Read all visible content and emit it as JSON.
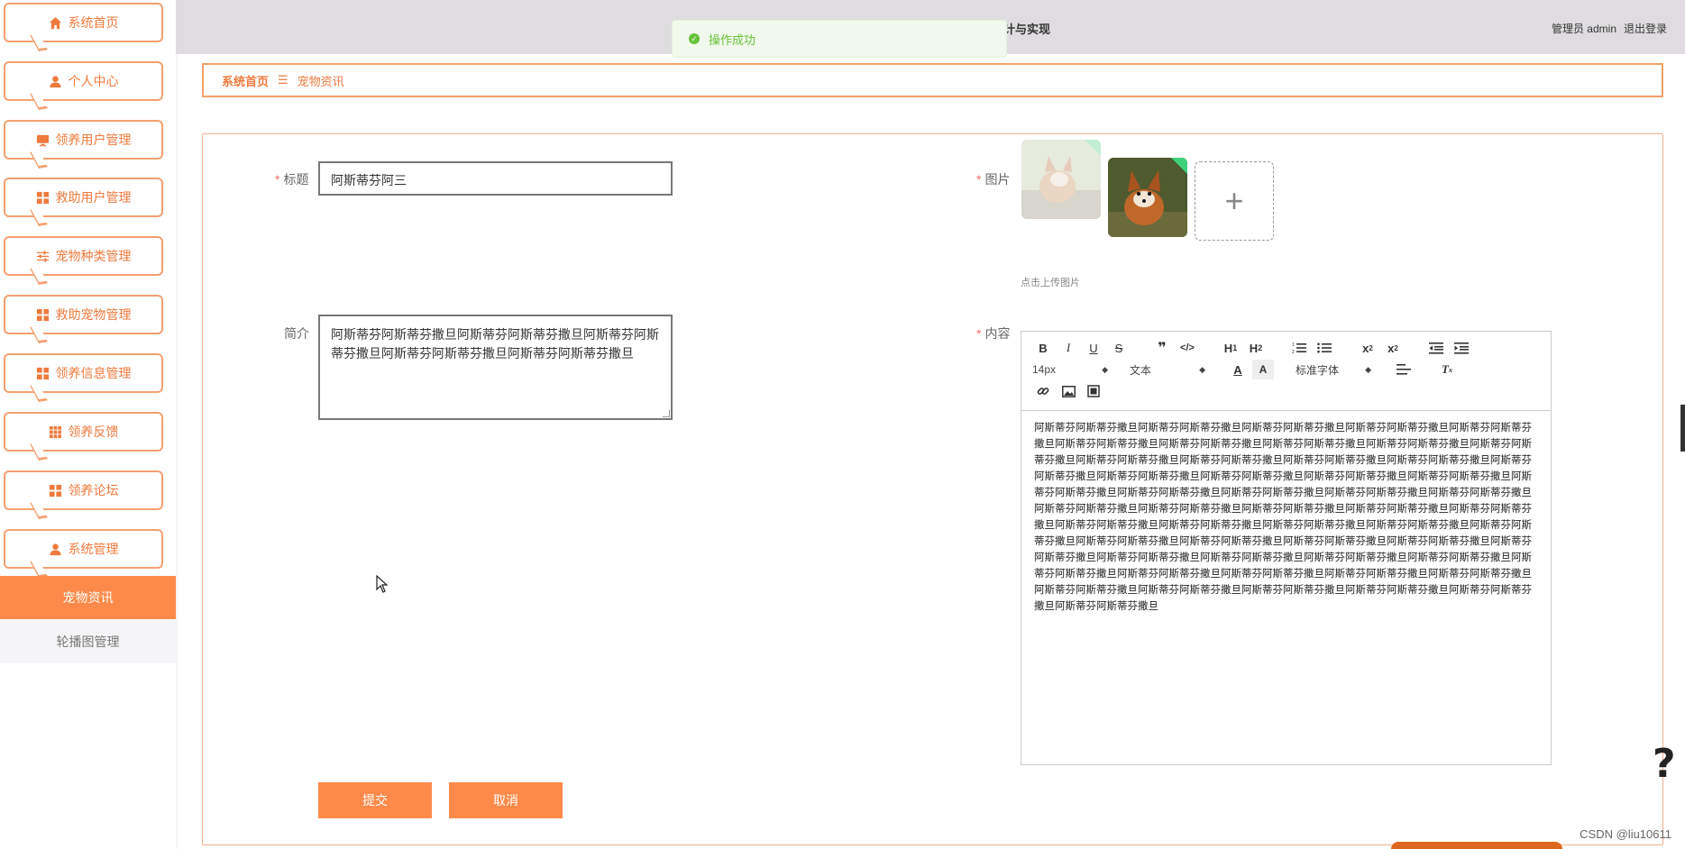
{
  "sidebar": {
    "items": [
      {
        "label": "系统首页",
        "icon": "home-icon"
      },
      {
        "label": "个人中心",
        "icon": "user-icon"
      },
      {
        "label": "领养用户管理",
        "icon": "monitor-icon"
      },
      {
        "label": "救助用户管理",
        "icon": "grid-icon"
      },
      {
        "label": "宠物种类管理",
        "icon": "sliders-icon"
      },
      {
        "label": "救助宠物管理",
        "icon": "grid-icon"
      },
      {
        "label": "领养信息管理",
        "icon": "grid-icon"
      },
      {
        "label": "领养反馈",
        "icon": "apps-icon"
      },
      {
        "label": "领养论坛",
        "icon": "grid-icon"
      },
      {
        "label": "系统管理",
        "icon": "user-icon"
      }
    ],
    "sub_items": [
      {
        "label": "宠物资讯",
        "active": true
      },
      {
        "label": "轮播图管理",
        "active": false
      }
    ]
  },
  "header": {
    "title": "计与实现",
    "user": "管理员 admin",
    "logout": "退出登录"
  },
  "toast": {
    "message": "操作成功"
  },
  "breadcrumb": {
    "home": "系统首页",
    "separator": "☰",
    "current": "宠物资讯"
  },
  "form": {
    "title_label": "标题",
    "title_value": "阿斯蒂芬阿三",
    "image_label": "图片",
    "upload_tip": "点击上传图片",
    "upload_plus": "+",
    "intro_label": "简介",
    "intro_value": "阿斯蒂芬阿斯蒂芬撒旦阿斯蒂芬阿斯蒂芬撒旦阿斯蒂芬阿斯蒂芬撒旦阿斯蒂芬阿斯蒂芬撒旦阿斯蒂芬阿斯蒂芬撒旦",
    "content_label": "内容",
    "content_value": "阿斯蒂芬阿斯蒂芬撒旦阿斯蒂芬阿斯蒂芬撒旦阿斯蒂芬阿斯蒂芬撒旦阿斯蒂芬阿斯蒂芬撒旦阿斯蒂芬阿斯蒂芬撒旦阿斯蒂芬阿斯蒂芬撒旦阿斯蒂芬阿斯蒂芬撒旦阿斯蒂芬阿斯蒂芬撒旦阿斯蒂芬阿斯蒂芬撒旦阿斯蒂芬阿斯蒂芬撒旦阿斯蒂芬阿斯蒂芬撒旦阿斯蒂芬阿斯蒂芬撒旦阿斯蒂芬阿斯蒂芬撒旦阿斯蒂芬阿斯蒂芬撒旦阿斯蒂芬阿斯蒂芬撒旦阿斯蒂芬阿斯蒂芬撒旦阿斯蒂芬阿斯蒂芬撒旦阿斯蒂芬阿斯蒂芬撒旦阿斯蒂芬阿斯蒂芬撒旦阿斯蒂芬阿斯蒂芬撒旦阿斯蒂芬阿斯蒂芬撒旦阿斯蒂芬阿斯蒂芬撒旦阿斯蒂芬阿斯蒂芬撒旦阿斯蒂芬阿斯蒂芬撒旦阿斯蒂芬阿斯蒂芬撒旦阿斯蒂芬阿斯蒂芬撒旦阿斯蒂芬阿斯蒂芬撒旦阿斯蒂芬阿斯蒂芬撒旦阿斯蒂芬阿斯蒂芬撒旦阿斯蒂芬阿斯蒂芬撒旦阿斯蒂芬阿斯蒂芬撒旦阿斯蒂芬阿斯蒂芬撒旦阿斯蒂芬阿斯蒂芬撒旦阿斯蒂芬阿斯蒂芬撒旦阿斯蒂芬阿斯蒂芬撒旦阿斯蒂芬阿斯蒂芬撒旦阿斯蒂芬阿斯蒂芬撒旦阿斯蒂芬阿斯蒂芬撒旦阿斯蒂芬阿斯蒂芬撒旦阿斯蒂芬阿斯蒂芬撒旦阿斯蒂芬阿斯蒂芬撒旦阿斯蒂芬阿斯蒂芬撒旦阿斯蒂芬阿斯蒂芬撒旦阿斯蒂芬阿斯蒂芬撒旦阿斯蒂芬阿斯蒂芬撒旦阿斯蒂芬阿斯蒂芬撒旦阿斯蒂芬阿斯蒂芬撒旦阿斯蒂芬阿斯蒂芬撒旦阿斯蒂芬阿斯蒂芬撒旦阿斯蒂芬阿斯蒂芬撒旦阿斯蒂芬阿斯蒂芬撒旦阿斯蒂芬阿斯蒂芬撒旦阿斯蒂芬阿斯蒂芬撒旦阿斯蒂芬阿斯蒂芬撒旦",
    "submit": "提交",
    "cancel": "取消"
  },
  "editor": {
    "font_size": "14px",
    "block_type": "文本",
    "font_family": "标准字体"
  },
  "watermark": "CSDN @liu10611",
  "colors": {
    "accent": "#fe8a4a",
    "accent_text": "#ee7a3e",
    "success": "#67c23a",
    "required": "#f56c6c"
  }
}
